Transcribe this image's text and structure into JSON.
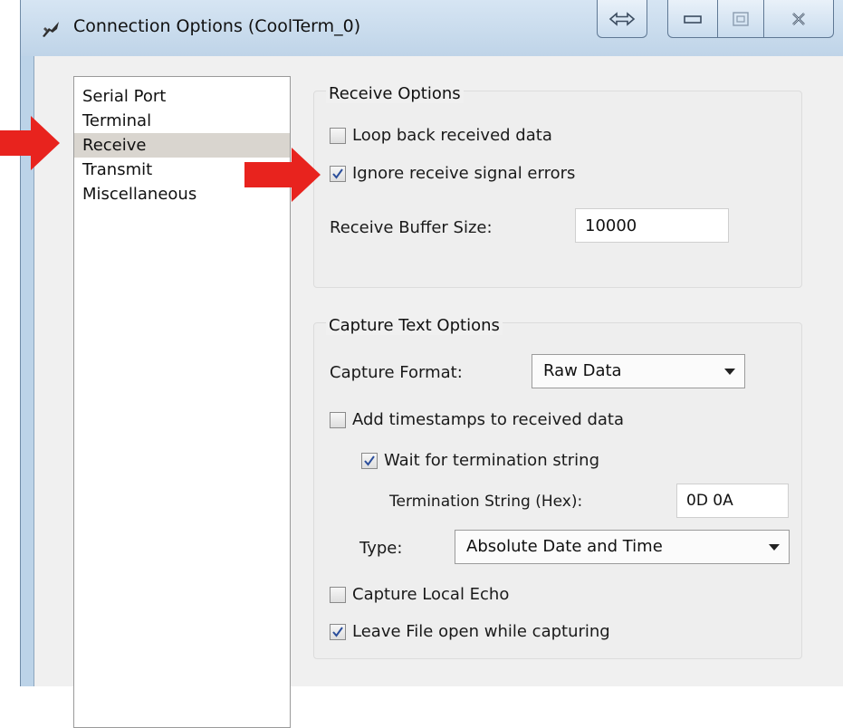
{
  "window": {
    "title": "Connection Options (CoolTerm_0)",
    "icons": [
      "app-icon",
      "swap-icon",
      "minimize-icon",
      "maximize-icon",
      "close-icon"
    ]
  },
  "nav": {
    "items": [
      {
        "label": "Serial Port",
        "selected": false
      },
      {
        "label": "Terminal",
        "selected": false
      },
      {
        "label": "Receive",
        "selected": true
      },
      {
        "label": "Transmit",
        "selected": false
      },
      {
        "label": "Miscellaneous",
        "selected": false
      }
    ]
  },
  "receive_options": {
    "title": "Receive Options",
    "loop_back": {
      "label": "Loop back received data",
      "checked": false
    },
    "ignore_errors": {
      "label": "Ignore receive signal errors",
      "checked": true
    },
    "buffer_size": {
      "label": "Receive Buffer Size:",
      "value": "10000"
    }
  },
  "capture_options": {
    "title": "Capture Text Options",
    "format": {
      "label": "Capture Format:",
      "value": "Raw Data"
    },
    "add_timestamps": {
      "label": "Add timestamps to received data",
      "checked": false
    },
    "wait_termination": {
      "label": "Wait for termination string",
      "checked": true
    },
    "termination_string": {
      "label": "Termination String (Hex):",
      "value": "0D 0A"
    },
    "type": {
      "label": "Type:",
      "value": "Absolute Date and Time"
    },
    "local_echo": {
      "label": "Capture Local Echo",
      "checked": false
    },
    "leave_open": {
      "label": "Leave File open while capturing",
      "checked": true
    }
  },
  "colors": {
    "annotation_arrow": "#e8231e",
    "selection": "#d9d5cf"
  }
}
